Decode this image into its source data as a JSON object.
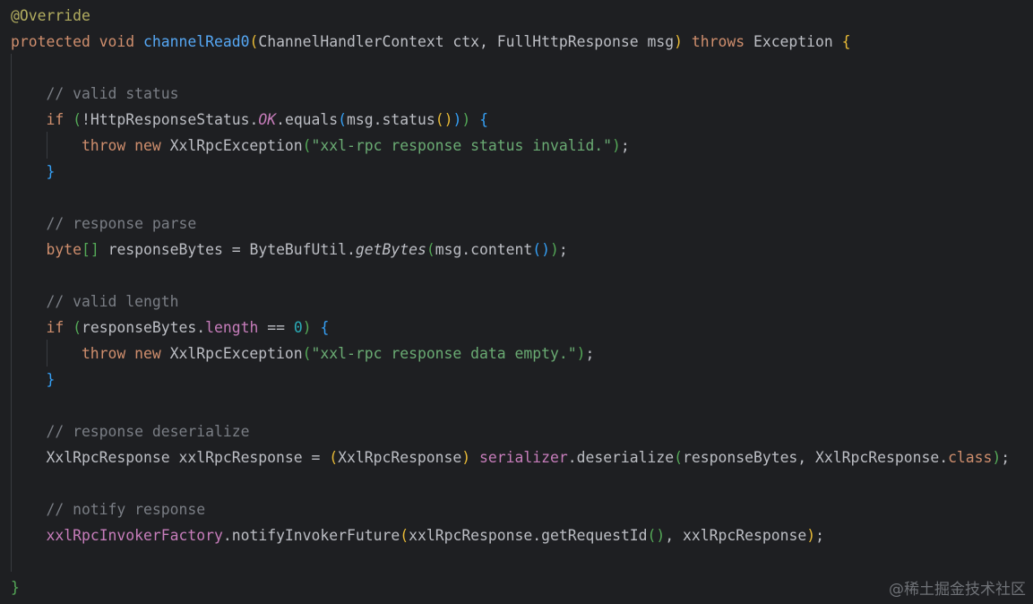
{
  "editor": {
    "background": "#1e1f22",
    "lines": [
      [
        {
          "t": "@Override",
          "c": "ann"
        }
      ],
      [
        {
          "t": "protected void ",
          "c": "kw"
        },
        {
          "t": "channelRead0",
          "c": "fn"
        },
        {
          "t": "(",
          "c": "p1"
        },
        {
          "t": "ChannelHandlerContext ctx, FullHttpResponse msg",
          "c": "plain"
        },
        {
          "t": ")",
          "c": "p1"
        },
        {
          "t": " throws ",
          "c": "kw"
        },
        {
          "t": "Exception ",
          "c": "plain"
        },
        {
          "t": "{",
          "c": "p1"
        }
      ],
      [],
      [
        {
          "t": "    // valid status",
          "c": "cmt"
        }
      ],
      [
        {
          "t": "    if ",
          "c": "kw"
        },
        {
          "t": "(",
          "c": "p2"
        },
        {
          "t": "!HttpResponseStatus.",
          "c": "plain"
        },
        {
          "t": "OK",
          "c": "sfld"
        },
        {
          "t": ".equals",
          "c": "plain"
        },
        {
          "t": "(",
          "c": "p3"
        },
        {
          "t": "msg.status",
          "c": "plain"
        },
        {
          "t": "()",
          "c": "p1"
        },
        {
          "t": ")",
          "c": "p3"
        },
        {
          "t": ")",
          "c": "p2"
        },
        {
          "t": " ",
          "c": "plain"
        },
        {
          "t": "{",
          "c": "p3"
        }
      ],
      [
        {
          "t": "        throw new ",
          "c": "kw"
        },
        {
          "t": "XxlRpcException",
          "c": "plain"
        },
        {
          "t": "(",
          "c": "p2"
        },
        {
          "t": "\"xxl-rpc response status invalid.\"",
          "c": "str"
        },
        {
          "t": ")",
          "c": "p2"
        },
        {
          "t": ";",
          "c": "plain"
        }
      ],
      [
        {
          "t": "    }",
          "c": "p3"
        }
      ],
      [],
      [
        {
          "t": "    // response parse",
          "c": "cmt"
        }
      ],
      [
        {
          "t": "    byte",
          "c": "kw"
        },
        {
          "t": "[]",
          "c": "p2"
        },
        {
          "t": " responseBytes = ByteBufUtil.",
          "c": "plain"
        },
        {
          "t": "getBytes",
          "c": "smeth"
        },
        {
          "t": "(",
          "c": "p2"
        },
        {
          "t": "msg.content",
          "c": "plain"
        },
        {
          "t": "()",
          "c": "p3"
        },
        {
          "t": ")",
          "c": "p2"
        },
        {
          "t": ";",
          "c": "plain"
        }
      ],
      [],
      [
        {
          "t": "    // valid length",
          "c": "cmt"
        }
      ],
      [
        {
          "t": "    if ",
          "c": "kw"
        },
        {
          "t": "(",
          "c": "p2"
        },
        {
          "t": "responseBytes.",
          "c": "plain"
        },
        {
          "t": "length",
          "c": "fld"
        },
        {
          "t": " == ",
          "c": "plain"
        },
        {
          "t": "0",
          "c": "num"
        },
        {
          "t": ")",
          "c": "p2"
        },
        {
          "t": " ",
          "c": "plain"
        },
        {
          "t": "{",
          "c": "p3"
        }
      ],
      [
        {
          "t": "        throw new ",
          "c": "kw"
        },
        {
          "t": "XxlRpcException",
          "c": "plain"
        },
        {
          "t": "(",
          "c": "p2"
        },
        {
          "t": "\"xxl-rpc response data empty.\"",
          "c": "str"
        },
        {
          "t": ")",
          "c": "p2"
        },
        {
          "t": ";",
          "c": "plain"
        }
      ],
      [
        {
          "t": "    }",
          "c": "p3"
        }
      ],
      [],
      [
        {
          "t": "    // response deserialize",
          "c": "cmt"
        }
      ],
      [
        {
          "t": "    XxlRpcResponse xxlRpcResponse = ",
          "c": "plain"
        },
        {
          "t": "(",
          "c": "p1"
        },
        {
          "t": "XxlRpcResponse",
          "c": "plain"
        },
        {
          "t": ")",
          "c": "p1"
        },
        {
          "t": " ",
          "c": "plain"
        },
        {
          "t": "serializer",
          "c": "fld"
        },
        {
          "t": ".deserialize",
          "c": "plain"
        },
        {
          "t": "(",
          "c": "p2"
        },
        {
          "t": "responseBytes, XxlRpcResponse.",
          "c": "plain"
        },
        {
          "t": "class",
          "c": "kw"
        },
        {
          "t": ")",
          "c": "p2"
        },
        {
          "t": ";",
          "c": "plain"
        }
      ],
      [],
      [
        {
          "t": "    // notify response",
          "c": "cmt"
        }
      ],
      [
        {
          "t": "    ",
          "c": "plain"
        },
        {
          "t": "xxlRpcInvokerFactory",
          "c": "fld"
        },
        {
          "t": ".notifyInvokerFuture",
          "c": "plain"
        },
        {
          "t": "(",
          "c": "p1"
        },
        {
          "t": "xxlRpcResponse.getRequestId",
          "c": "plain"
        },
        {
          "t": "()",
          "c": "p2"
        },
        {
          "t": ", xxlRpcResponse",
          "c": "plain"
        },
        {
          "t": ")",
          "c": "p1"
        },
        {
          "t": ";",
          "c": "plain"
        }
      ],
      [],
      [
        {
          "t": "}",
          "c": "p2"
        }
      ]
    ]
  },
  "watermark": {
    "text": "@稀土掘金技术社区"
  }
}
